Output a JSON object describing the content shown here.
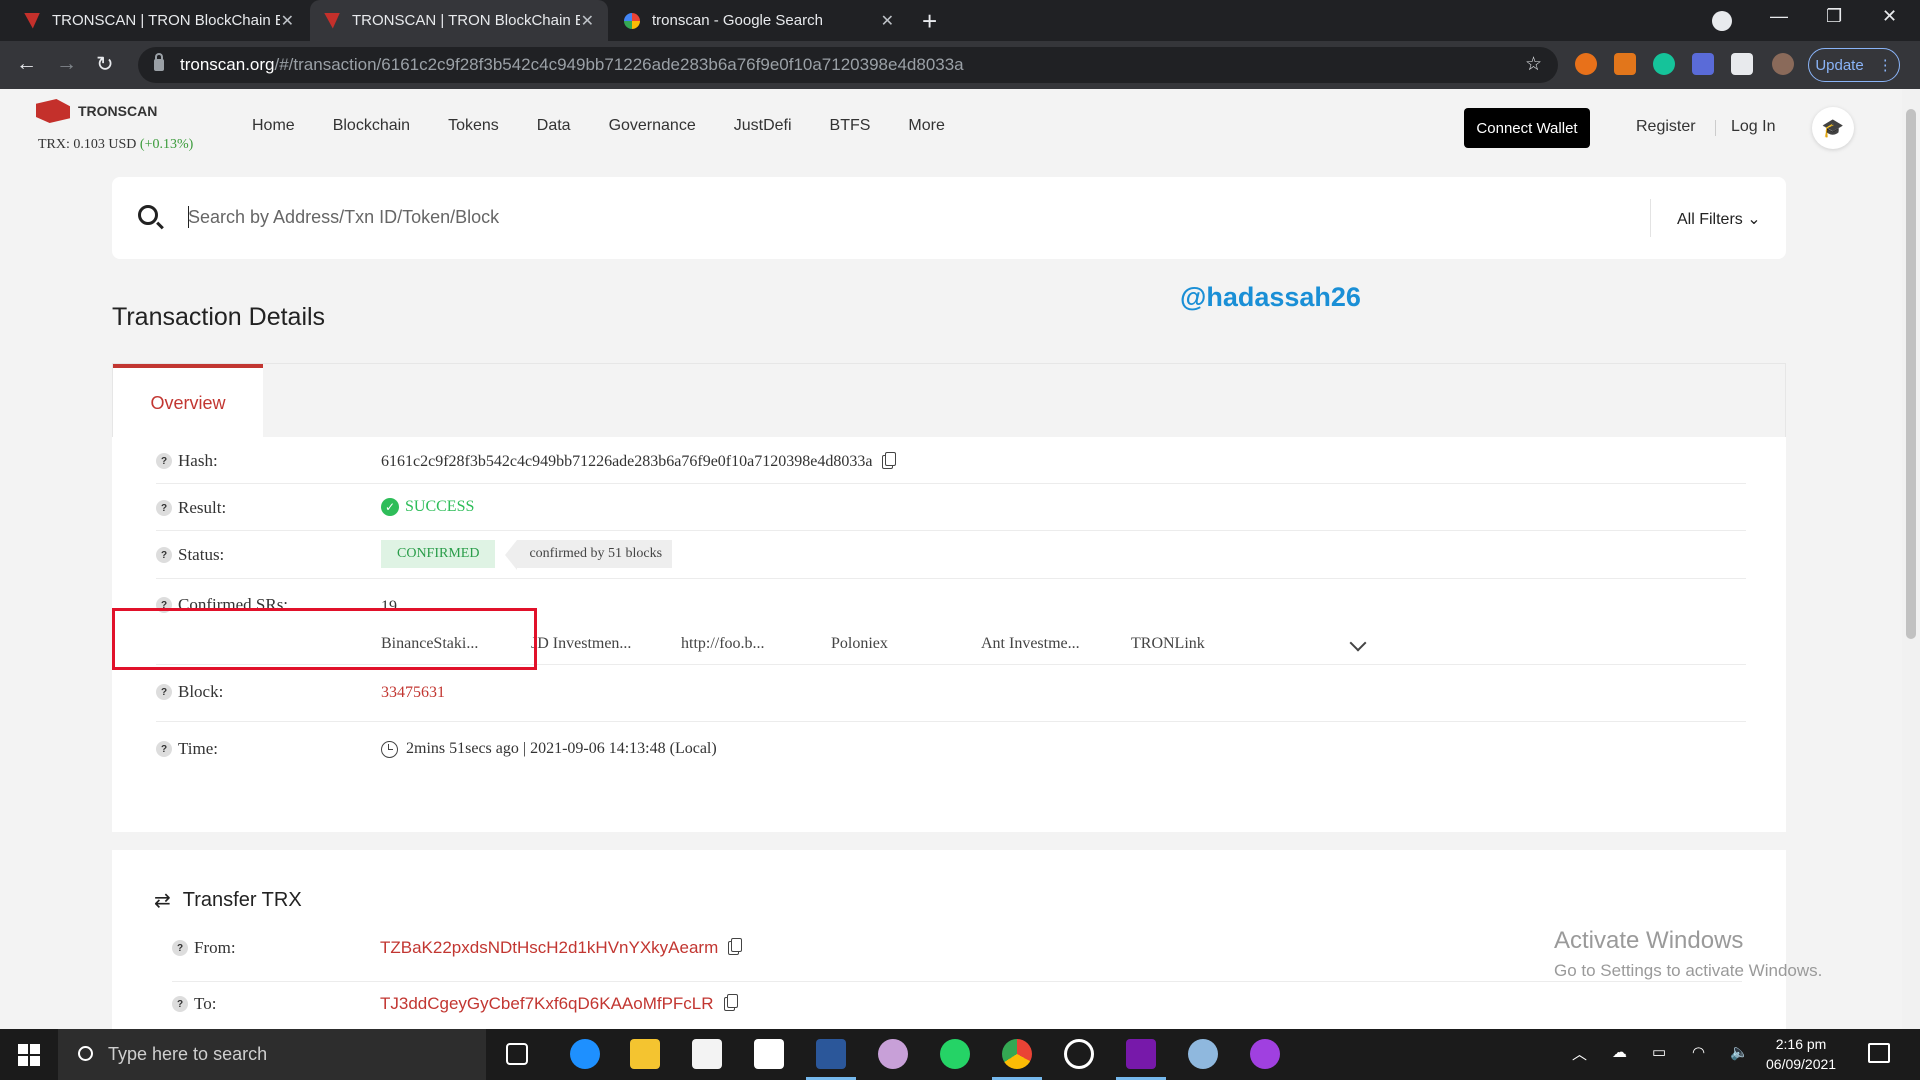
{
  "browser": {
    "tabs": [
      {
        "title": "TRONSCAN | TRON BlockChain E",
        "active": false
      },
      {
        "title": "TRONSCAN | TRON BlockChain E",
        "active": true
      },
      {
        "title": "tronscan - Google Search",
        "active": false
      }
    ],
    "url_host": "tronscan.org",
    "url_path": "/#/transaction/6161c2c9f28f3b542c4c949bb71226ade283b6a76f9e0f10a7120398e4d8033a",
    "update_label": "Update"
  },
  "site": {
    "brand": "TRONSCAN",
    "price_prefix": "TRX: 0.103 USD",
    "price_change": "(+0.13%)",
    "nav": [
      "Home",
      "Blockchain",
      "Tokens",
      "Data",
      "Governance",
      "JustDefi",
      "BTFS",
      "More"
    ],
    "connect_wallet": "Connect Wallet",
    "register": "Register",
    "login": "Log In"
  },
  "search": {
    "placeholder": "Search by Address/Txn ID/Token/Block",
    "filters_label": "All Filters"
  },
  "page": {
    "title": "Transaction Details",
    "handle": "@hadassah26",
    "tab_overview": "Overview"
  },
  "details": {
    "hash_label": "Hash:",
    "hash": "6161c2c9f28f3b542c4c949bb71226ade283b6a76f9e0f10a7120398e4d8033a",
    "result_label": "Result:",
    "result": "SUCCESS",
    "status_label": "Status:",
    "status": "CONFIRMED",
    "confirmations": "confirmed by 51 blocks",
    "srs_label": "Confirmed SRs:",
    "srs_count": "19",
    "srs": [
      "BinanceStaki...",
      "JD Investmen...",
      "http://foo.b...",
      "Poloniex",
      "Ant Investme...",
      "TRONLink"
    ],
    "block_label": "Block:",
    "block": "33475631",
    "time_label": "Time:",
    "time": "2mins 51secs ago | 2021-09-06 14:13:48 (Local)"
  },
  "transfer": {
    "title": "Transfer TRX",
    "from_label": "From:",
    "from": "TZBaK22pxdsNDtHscH2d1kHVnYXkyAearm",
    "to_label": "To:",
    "to": "TJ3ddCgeyGyCbef7Kxf6qD6KAAoMfPFcLR"
  },
  "watermark": {
    "line1": "Activate Windows",
    "line2": "Go to Settings to activate Windows."
  },
  "taskbar": {
    "search_placeholder": "Type here to search",
    "time": "2:16 pm",
    "date": "06/09/2021"
  },
  "colors": {
    "accent_red": "#c23631",
    "success_green": "#2ebd59",
    "handle_blue": "#1a8fd6",
    "highlight_red": "#e1112a"
  }
}
